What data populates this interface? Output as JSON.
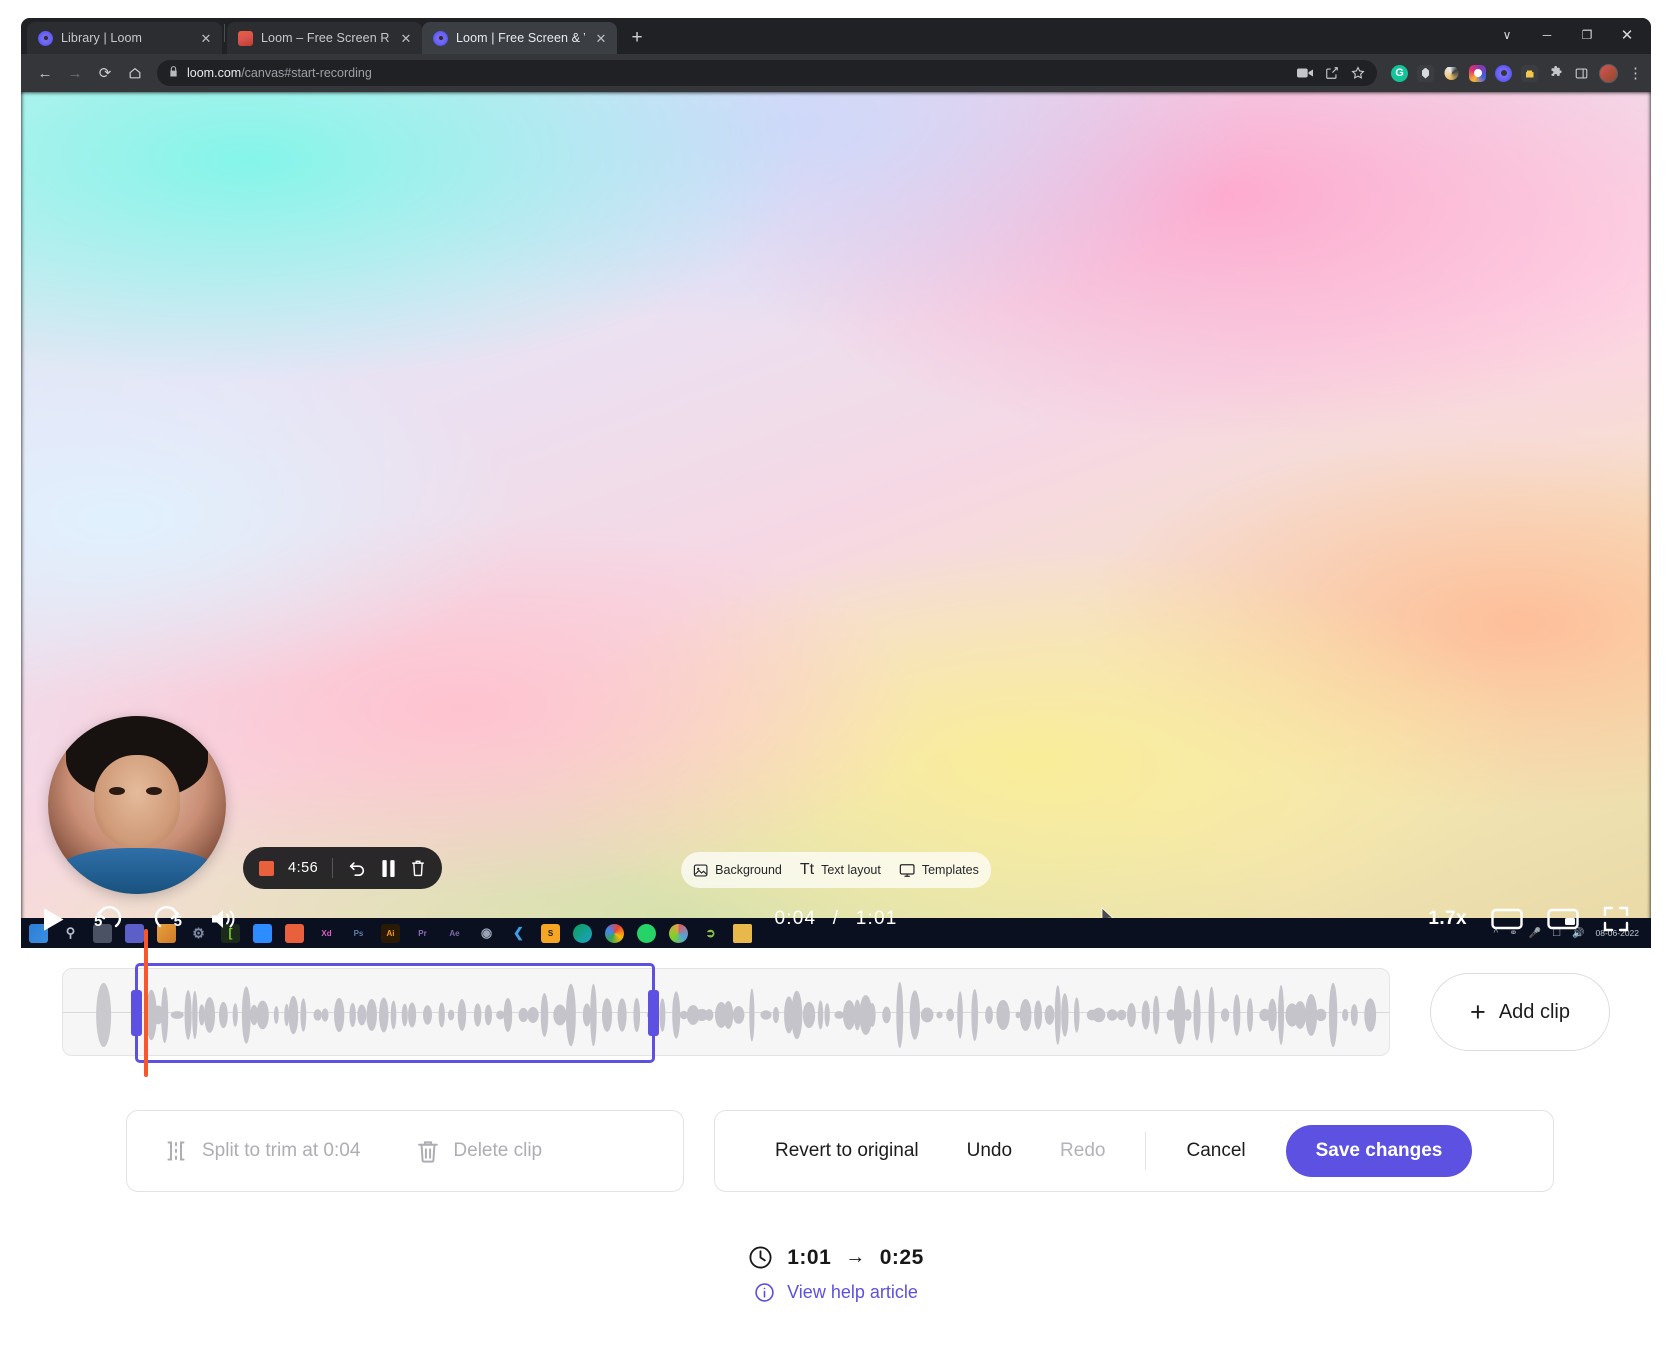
{
  "browser": {
    "tabs": [
      {
        "title": "Library | Loom",
        "favicon": "loom-icon",
        "active": false
      },
      {
        "title": "Loom – Free Screen Recorder & S",
        "favicon": "image-icon",
        "active": false
      },
      {
        "title": "Loom | Free Screen & Video Rec",
        "favicon": "loom-icon",
        "active": true
      }
    ],
    "new_tab_label": "+",
    "window_controls": {
      "expand": "∨",
      "minimize": "─",
      "maximize": "❐",
      "close": "✕"
    },
    "nav": {
      "back": "←",
      "forward": "→",
      "reload": "⟳",
      "home": "⌂"
    },
    "omnibox": {
      "lock_icon": "lock-icon",
      "url_domain": "loom.com",
      "url_path": "/canvas#start-recording"
    },
    "omnibox_actions": [
      "camera-icon",
      "share-icon",
      "bookmark-star-icon"
    ],
    "extensions": [
      "grammarly-icon",
      "honey-icon",
      "adobe-icon",
      "instagram-icon",
      "loom-extension-icon",
      "password-lock-icon",
      "puzzle-extensions-icon",
      "split-screen-icon",
      "profile-avatar"
    ],
    "menu_icon": "three-dot-menu-icon"
  },
  "recording_pill": {
    "stop_icon": "stop-square-icon",
    "elapsed": "4:56",
    "restart_icon": "undo-restart-icon",
    "pause_icon": "pause-icon",
    "delete_icon": "trash-icon"
  },
  "editor_pill": {
    "items": [
      {
        "label": "Background",
        "icon": "image-icon"
      },
      {
        "label": "Text layout",
        "icon": "text-tt-icon"
      },
      {
        "label": "Templates",
        "icon": "monitor-icon"
      }
    ]
  },
  "player": {
    "play_icon": "play-icon",
    "rewind_label": "5",
    "forward_label": "5",
    "volume_icon": "volume-icon",
    "current_time": "0:04",
    "separator": "/",
    "total_time": "1:01",
    "speed": "1.7x",
    "theater_icon": "theater-mode-icon",
    "pip_icon": "picture-in-picture-icon",
    "fullscreen_icon": "fullscreen-icon"
  },
  "taskbar": {
    "apps": [
      "windows-start-icon",
      "search-icon",
      "task-view-icon",
      "teams-icon",
      "store-icon",
      "settings-icon",
      "camtasia-icon",
      "zoom-icon",
      "illustrator-id-icon",
      "xd-icon",
      "photoshop-icon",
      "ai-icon",
      "premiere-icon",
      "after-effects-icon",
      "blender-icon",
      "vscode-icon",
      "s-app-icon",
      "edge-icon",
      "chrome-icon",
      "whatsapp-icon",
      "app-icon",
      "cursor-icon",
      "folder-icon"
    ],
    "xd_label": "Xd",
    "ps_label": "Ps",
    "ai_label": "Ai",
    "pr_label": "Pr",
    "ae_label": "Ae",
    "tray": [
      "chevron-up-icon",
      "network-icon",
      "mic-icon",
      "display-icon",
      "volume-tray-icon"
    ],
    "clock_time": "",
    "clock_date": "08-06-2022"
  },
  "timeline": {
    "add_clip_label": "Add clip",
    "add_clip_plus": "+",
    "playhead_color": "#f9572b",
    "selection_color": "#5c51e0"
  },
  "clip_actions": {
    "split_label": "Split to trim at 0:04",
    "split_icon": "split-brackets-icon",
    "delete_label": "Delete clip",
    "delete_icon": "trash-icon"
  },
  "history_actions": {
    "revert_label": "Revert to original",
    "undo_label": "Undo",
    "redo_label": "Redo",
    "cancel_label": "Cancel",
    "save_label": "Save changes"
  },
  "footer": {
    "clock_icon": "clock-icon",
    "original_duration": "1:01",
    "arrow": "→",
    "new_duration": "0:25",
    "info_icon": "info-circle-icon",
    "help_label": "View help article"
  },
  "colors": {
    "brand_purple": "#5c51e0",
    "playhead_orange": "#f9572b",
    "chrome_dark": "#202124"
  }
}
